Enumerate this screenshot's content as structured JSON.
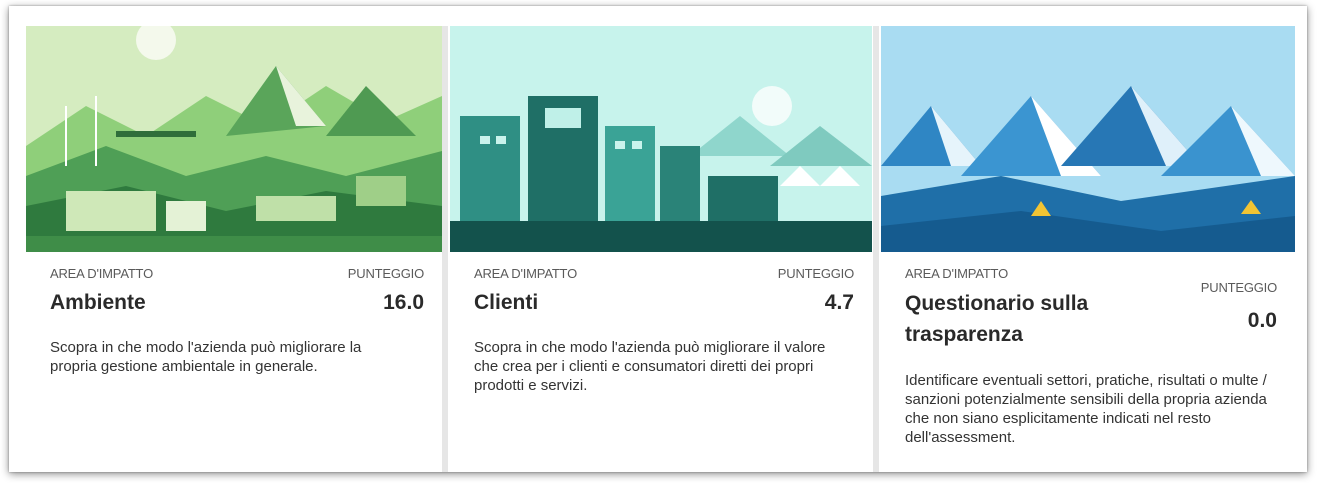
{
  "cards": [
    {
      "area_label": "AREA D'IMPATTO",
      "score_label": "PUNTEGGIO",
      "title": "Ambiente",
      "score": "16.0",
      "description": "Scopra in che modo l'azienda può migliorare la propria gestione ambientale in generale.",
      "theme_color": "#6fb86a"
    },
    {
      "area_label": "AREA D'IMPATTO",
      "score_label": "PUNTEGGIO",
      "title": "Clienti",
      "score": "4.7",
      "description": "Scopra in che modo l'azienda può migliorare il valore che crea per i clienti e consumatori diretti dei propri prodotti e servizi.",
      "theme_color": "#2a8f86"
    },
    {
      "area_label": "AREA D'IMPATTO",
      "score_label": "PUNTEGGIO",
      "title": "Questionario sulla trasparenza",
      "score": "0.0",
      "description": "Identificare eventuali settori, pratiche, risultati o multe / sanzioni potenzialmente sensibili della propria azienda che non siano esplicitamente indicati nel resto dell'assessment.",
      "theme_color": "#2f86c4"
    }
  ]
}
